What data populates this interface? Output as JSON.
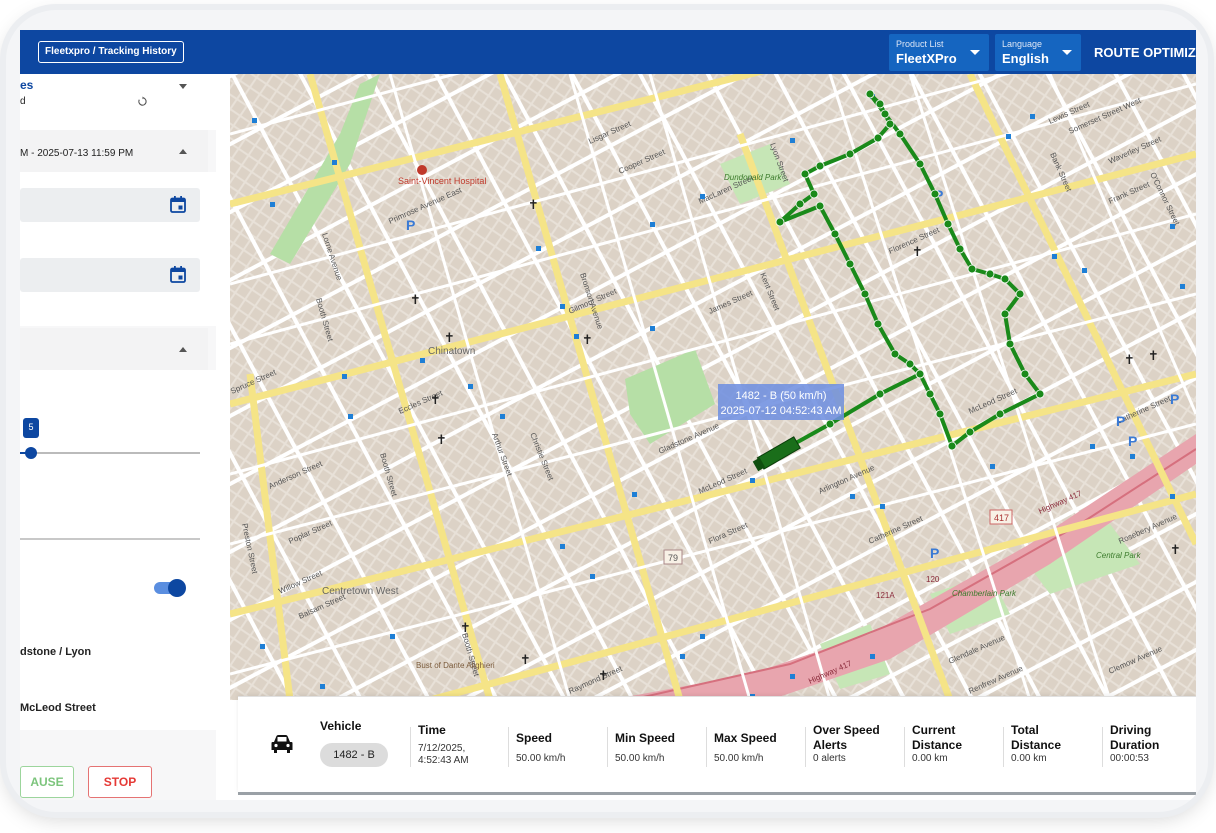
{
  "topbar": {
    "breadcrumb": "Fleetxpro / Tracking History",
    "product_list": {
      "label": "Product List",
      "value": "FleetXPro"
    },
    "language": {
      "label": "Language",
      "value": "English"
    },
    "route_button": "ROUTE OPTIMIZ"
  },
  "sidebar": {
    "section1_title": "es",
    "section1_sub": "d",
    "date_range": "M - 2025-07-13 11:59 PM",
    "slider_value": "5",
    "slider_level": 0.06,
    "toggle_on": true,
    "stop_1": "dstone / Lyon",
    "stop_2": "McLeod Street",
    "pause_label": "AUSE",
    "stop_label": "STOP"
  },
  "map": {
    "popup_line1": "1482 - B (50 km/h)",
    "popup_line2": "2025-07-12 04:52:43 AM",
    "route_color": "#1a8a1a",
    "labels": {
      "street_lorne": "Lorne Avenue",
      "street_booth": "Booth Street",
      "street_bronson": "Bronson Avenue",
      "street_lyon": "Lyon Street",
      "street_kent": "Kent Street",
      "street_bank": "Bank Street",
      "street_preston": "Preston Street",
      "street_gladstone": "Gladstone Avenue",
      "street_catherine": "Catherine Street",
      "street_mcleod": "McLeod Street",
      "street_flora": "Flora Street",
      "street_arlington": "Arlington Avenue",
      "street_florence": "Florence Street",
      "street_james": "James Street",
      "street_maclaren": "MacLaren Street",
      "street_gilmour": "Gilmour Street",
      "street_cooper": "Cooper Street",
      "street_somerset": "Somerset Street West",
      "street_lisgar": "Lisgar Street",
      "street_primrose": "Primrose Avenue East",
      "street_eccles": "Eccles Street",
      "street_anderson": "Anderson Street",
      "street_poplar": "Poplar Street",
      "street_willow": "Willow Street",
      "street_balsam": "Balsam Street",
      "street_spruce": "Spruce Street",
      "street_raymond": "Raymond Street",
      "street_glendale": "Glendale Avenue",
      "street_renfrew": "Renfrew Avenue",
      "street_clemow": "Clemow Avenue",
      "street_rosebery": "Rosebery Avenue",
      "street_oconnor": "O'Connor Street",
      "street_waverley": "Waverley Street",
      "street_frank": "Frank Street",
      "street_lewis": "Lewis Street",
      "street_christie": "Christie Street",
      "street_arthur": "Arthur Street",
      "hospital": "Saint-Vincent Hospital",
      "chinatown": "Chinatown",
      "centretown_west": "Centretown West",
      "dundonald_park": "Dundonald Park",
      "central_park": "Central Park",
      "chamberlain_park": "Chamberlain Park",
      "bust": "Bust of Dante Alighieri",
      "highway": "Highway 417",
      "shield_417": "417",
      "shield_79": "79",
      "exit_121a": "121A",
      "exit_120": "120"
    }
  },
  "info": {
    "vehicle": {
      "label": "Vehicle",
      "value": "1482 - B"
    },
    "time": {
      "label": "Time",
      "value": "7/12/2025, 4:52:43 AM"
    },
    "speed": {
      "label": "Speed",
      "value": "50.00 km/h"
    },
    "min_speed": {
      "label": "Min Speed",
      "value": "50.00 km/h"
    },
    "max_speed": {
      "label": "Max Speed",
      "value": "50.00 km/h"
    },
    "over_speed": {
      "label": "Over Speed Alerts",
      "value": "0 alerts"
    },
    "current_distance": {
      "label": "Current Distance",
      "value": "0.00 km"
    },
    "total_distance": {
      "label": "Total Distance",
      "value": "0.00 km"
    },
    "driving_duration": {
      "label": "Driving Duration",
      "value": "00:00:53"
    }
  }
}
